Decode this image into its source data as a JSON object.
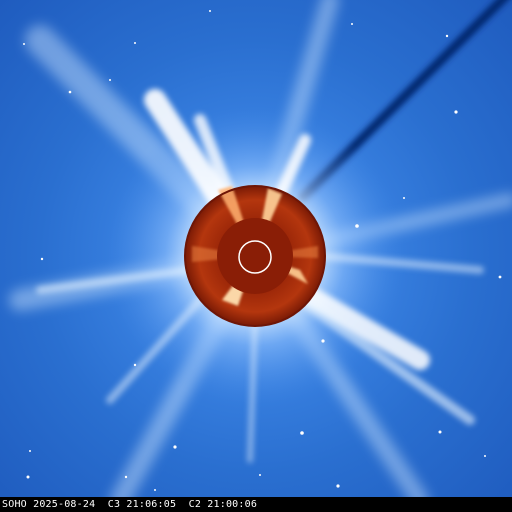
{
  "image": {
    "description_free": true,
    "colors": {
      "background_blue": "#2a6fd0",
      "corona_light": "#bfe0ff",
      "corona_white": "#ffffff",
      "occulter_red": "#a02a0a",
      "occulter_dark": "#6e1606",
      "occulter_bright": "#ffb070",
      "inner_disk": "#8a1e06",
      "sun_circle": "#ffffff",
      "dark_streak": "#0a2a7a"
    }
  },
  "caption": {
    "text": "SOHO 2025-08-24  C3 21:06:05  C2 21:00:06"
  }
}
